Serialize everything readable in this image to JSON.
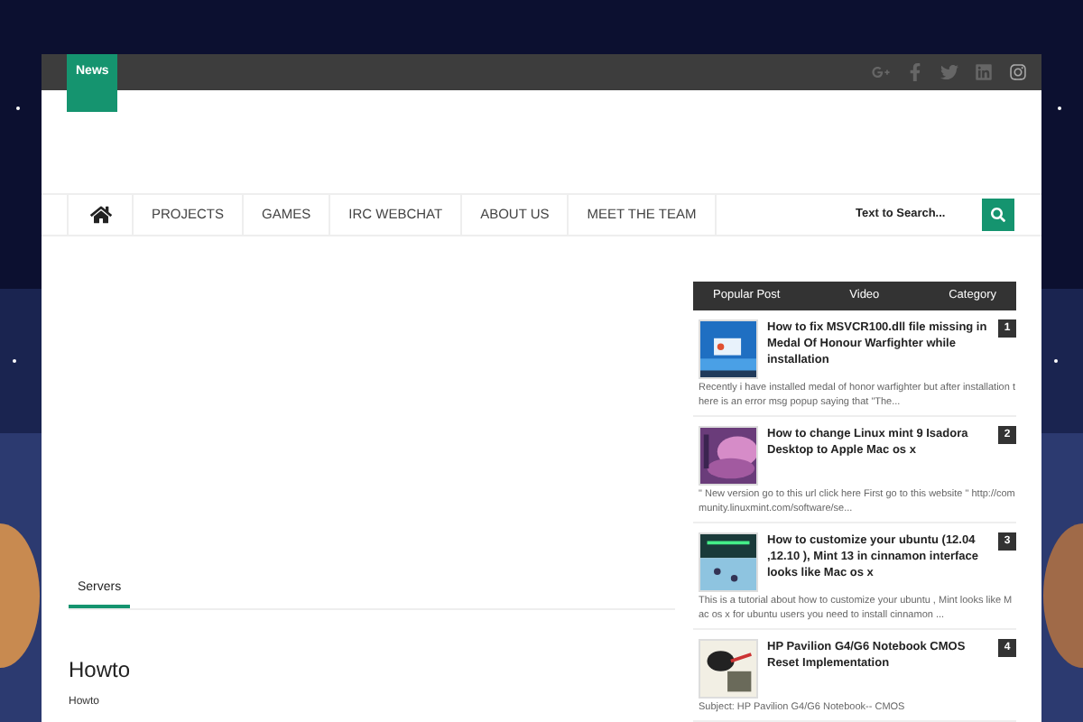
{
  "top_bar": {
    "badge": "News"
  },
  "nav": {
    "items": [
      "PROJECTS",
      "GAMES",
      "IRC WEBCHAT",
      "ABOUT US",
      "MEET THE TEAM"
    ],
    "search": {
      "placeholder": "Text to Search..."
    }
  },
  "sidebar": {
    "tabs": [
      "Popular Post",
      "Video",
      "Category"
    ],
    "posts": [
      {
        "number": "1",
        "title": "How to fix MSVCR100.dll file missing in Medal Of Honour Warfighter while installation",
        "excerpt": "Recently i have installed medal of honor warfighter but after installation there is an error msg popup saying that  \"The..."
      },
      {
        "number": "2",
        "title": "How to change Linux mint 9 Isadora Desktop to Apple Mac os x",
        "excerpt": "\" New version go to this url      click here First go to this website \" http://community.linuxmint.com/software/se..."
      },
      {
        "number": "3",
        "title": "How to customize your ubuntu (12.04 ,12.10 ), Mint 13 in cinnamon interface looks like Mac os x",
        "excerpt": "This is a tutorial about how to customize your ubuntu , Mint looks like Mac os x for ubuntu users you need to install cinnamon ..."
      },
      {
        "number": "4",
        "title": "HP Pavilion G4/G6 Notebook CMOS Reset Implementation",
        "excerpt": "Subject: HP Pavilion G4/G6 Notebook-- CMOS"
      }
    ]
  },
  "main": {
    "section_tab": "Servers",
    "heading": "Howto",
    "text": "Howto"
  }
}
